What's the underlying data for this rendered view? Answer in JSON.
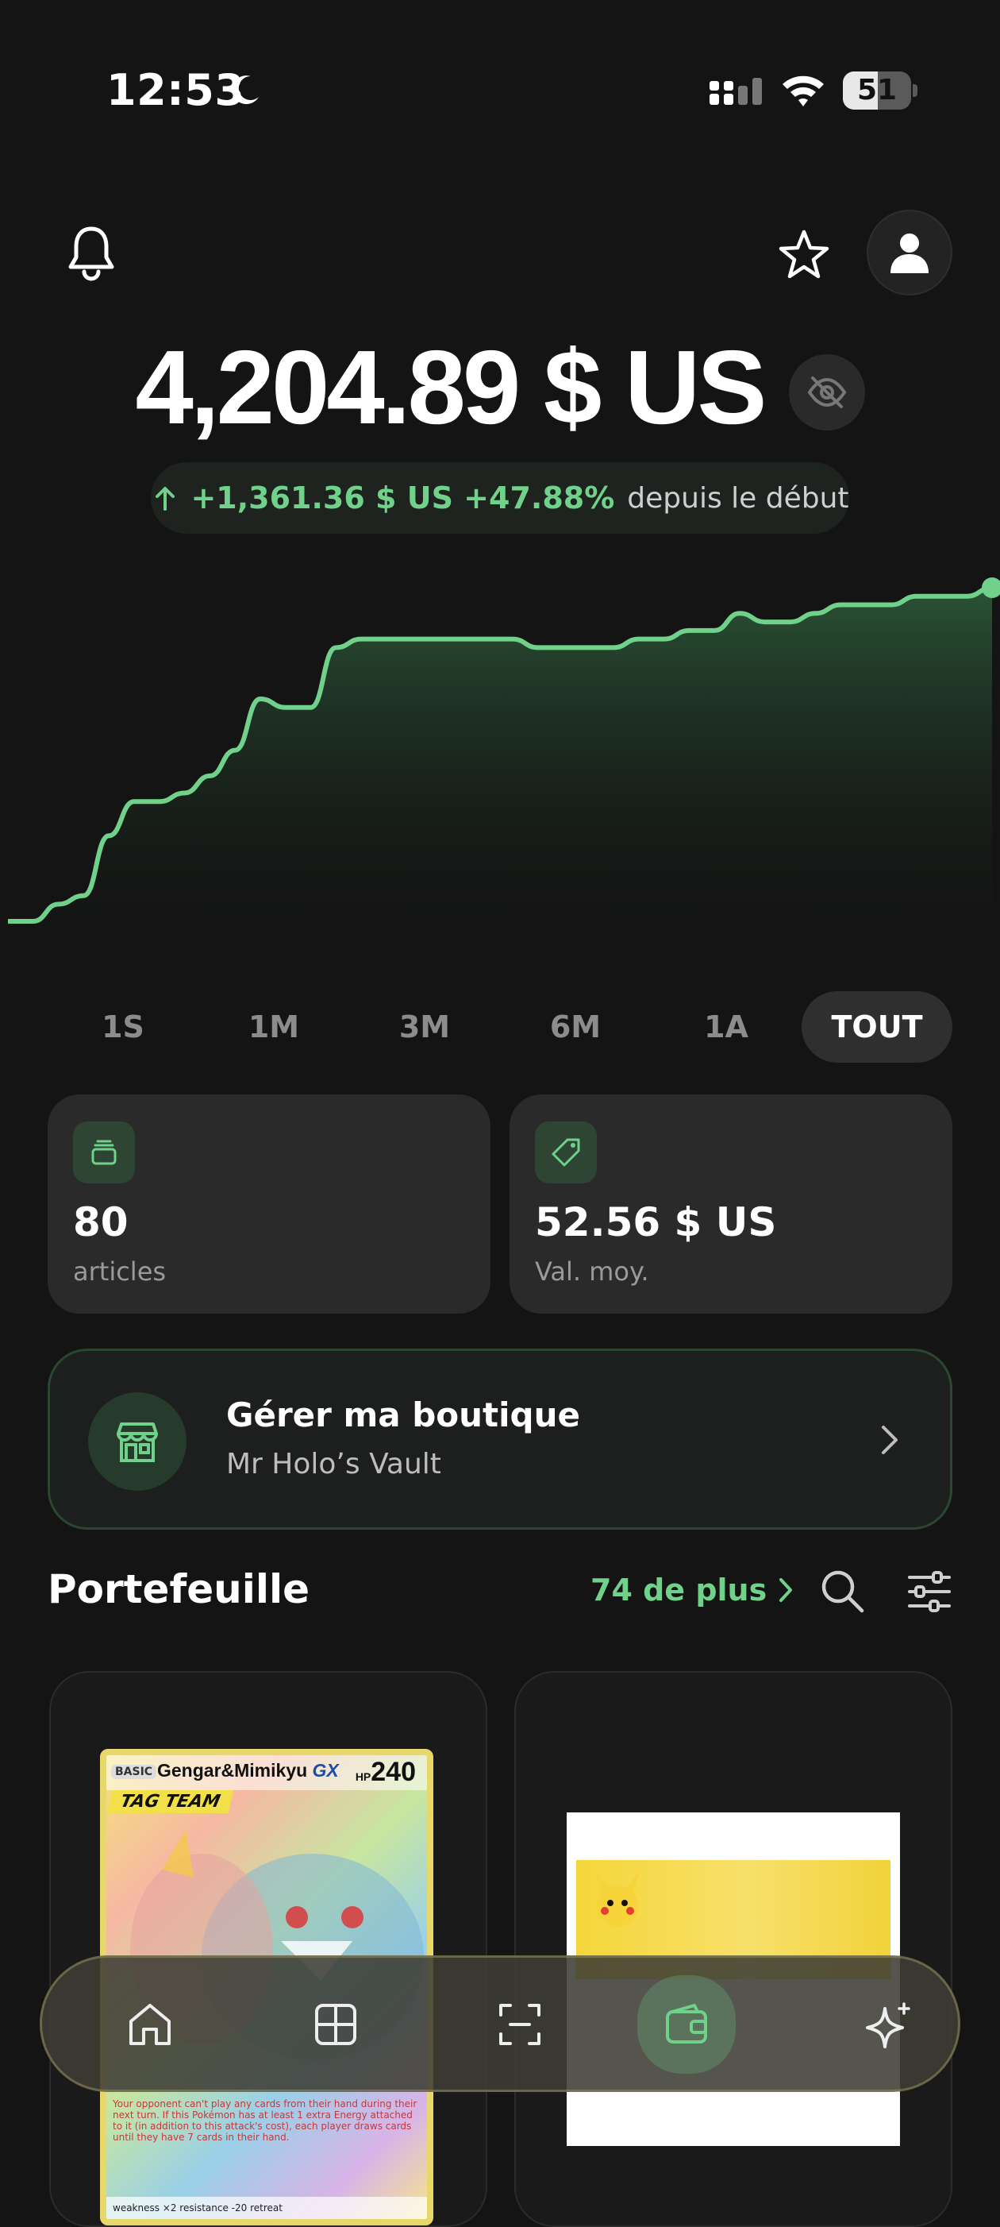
{
  "status_bar": {
    "time": "12:53",
    "battery_level": "51",
    "battery_fraction": 0.51
  },
  "balance": {
    "value": "4,204.89 $ US",
    "change": "+1,361.36 $ US +47.88%",
    "since_label": "depuis le début"
  },
  "chart_data": {
    "type": "area",
    "color": "#6fd18a",
    "values": [
      0,
      0,
      2,
      3,
      10,
      14,
      14,
      15,
      17,
      20,
      26,
      25,
      25,
      32,
      33,
      33,
      33,
      33,
      33,
      33,
      33,
      32,
      32,
      32,
      32,
      33,
      33,
      34,
      34,
      36,
      35,
      35,
      36,
      37,
      37,
      37,
      38,
      38,
      38,
      39
    ]
  },
  "range_tabs": [
    "1S",
    "1M",
    "3M",
    "6M",
    "1A",
    "TOUT"
  ],
  "active_range": "TOUT",
  "stats": {
    "articles_value": "80",
    "articles_label": "articles",
    "avg_value": "52.56 $ US",
    "avg_label": "Val. moy."
  },
  "shop": {
    "title": "Gérer ma boutique",
    "name": "Mr Holo’s Vault"
  },
  "portfolio": {
    "title": "Portefeuille",
    "more_label": "74 de plus",
    "cards": [
      {
        "basic": "BASIC",
        "name": "Gengar&Mimikyu",
        "gx": "GX",
        "hp_label": "HP",
        "hp": "240",
        "tag": "TAG TEAM",
        "text": "Your opponent can't play any cards from their hand during their next turn. If this Pokémon has at least 1 extra Energy attached to it (in addition to this attack's cost), each player draws cards until they have 7 cards in their hand.",
        "bottom": "weakness ×2   resistance -20   retreat"
      },
      {}
    ]
  },
  "colors": {
    "accent": "#6fd18a",
    "background": "#141414",
    "card": "#2a2a2a"
  },
  "icons": {
    "top_left": "bell-icon",
    "top_right": [
      "star-icon",
      "profile-icon"
    ],
    "nav": [
      "home-icon",
      "grid-icon",
      "scan-icon",
      "wallet-icon",
      "sparkle-icon"
    ]
  }
}
